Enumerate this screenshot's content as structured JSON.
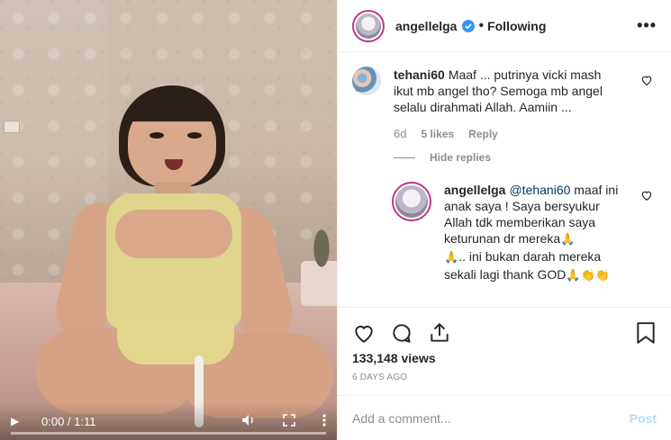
{
  "video": {
    "time_label": "0:00 / 1:11",
    "progress": 0.0,
    "play_icon": "play-icon",
    "volume_icon": "volume-icon",
    "fullscreen_icon": "fullscreen-icon",
    "menu_icon": "more-vertical-icon"
  },
  "header": {
    "username": "angellelga",
    "verified_icon": "verified-badge-icon",
    "separator": "•",
    "follow_status": "Following",
    "more_label": "•••"
  },
  "comments": [
    {
      "username": "tehani60",
      "text": "Maaf ... putrinya vicki mash ikut mb angel tho? Semoga mb angel selalu dirahmati Allah. Aamiin ...",
      "age": "6d",
      "likes": "5 likes",
      "reply_label": "Reply",
      "hide_replies_label": "Hide replies"
    }
  ],
  "reply": {
    "username": "angellelga",
    "mention": "@tehani60",
    "text_1": " maaf ini anak saya ! Saya bersyukur Allah tdk memberikan saya keturunan dr mereka",
    "emoji_1": "🙏",
    "emoji_2": "🙏",
    "text_2": ".. ini bukan darah mereka sekali lagi thank GOD",
    "emoji_3": "🙏👏👏"
  },
  "stats": {
    "views": "133,148 views",
    "posted": "6 DAYS AGO"
  },
  "add_comment": {
    "placeholder": "Add a comment...",
    "post_label": "Post"
  },
  "colors": {
    "story_ring": "#c13584",
    "verified": "#3897f0",
    "link": "#003569",
    "post_disabled": "#b2dffc",
    "muted": "#8e8e8e"
  }
}
